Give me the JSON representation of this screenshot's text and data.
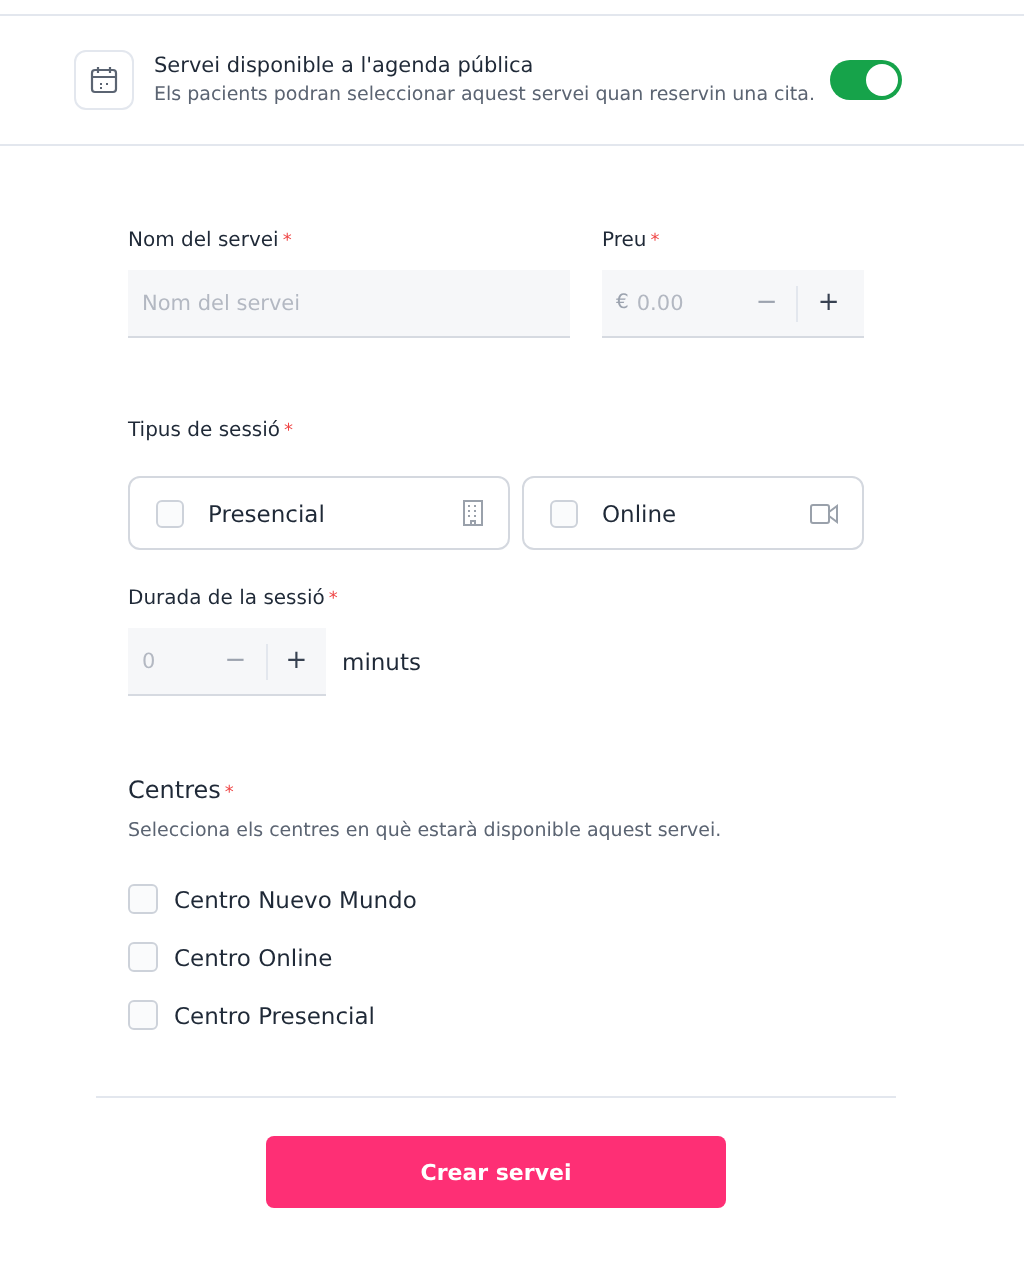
{
  "public_agenda": {
    "title": "Servei disponible a l'agenda pública",
    "description": "Els pacients podran seleccionar aquest servei quan reservin una cita.",
    "on": true
  },
  "name_field": {
    "label": "Nom del servei",
    "required_mark": "*",
    "placeholder": "Nom del servei"
  },
  "price_field": {
    "label": "Preu",
    "required_mark": "*",
    "currency": "€",
    "placeholder": "0.00",
    "decrement": "−",
    "increment": "+"
  },
  "session_type": {
    "label": "Tipus de sessió",
    "required_mark": "*",
    "options": [
      {
        "label": "Presencial",
        "kind": "building",
        "checked": false
      },
      {
        "label": "Online",
        "kind": "video",
        "checked": false
      }
    ]
  },
  "duration": {
    "label": "Durada de la sessió",
    "required_mark": "*",
    "placeholder": "0",
    "decrement": "−",
    "increment": "+",
    "unit": "minuts"
  },
  "centres": {
    "label": "Centres",
    "required_mark": "*",
    "description": "Selecciona els centres en què estarà disponible aquest servei.",
    "items": [
      {
        "label": "Centro Nuevo Mundo",
        "checked": false
      },
      {
        "label": "Centro Online",
        "checked": false
      },
      {
        "label": "Centro Presencial",
        "checked": false
      }
    ]
  },
  "submit": {
    "label": "Crear servei"
  }
}
